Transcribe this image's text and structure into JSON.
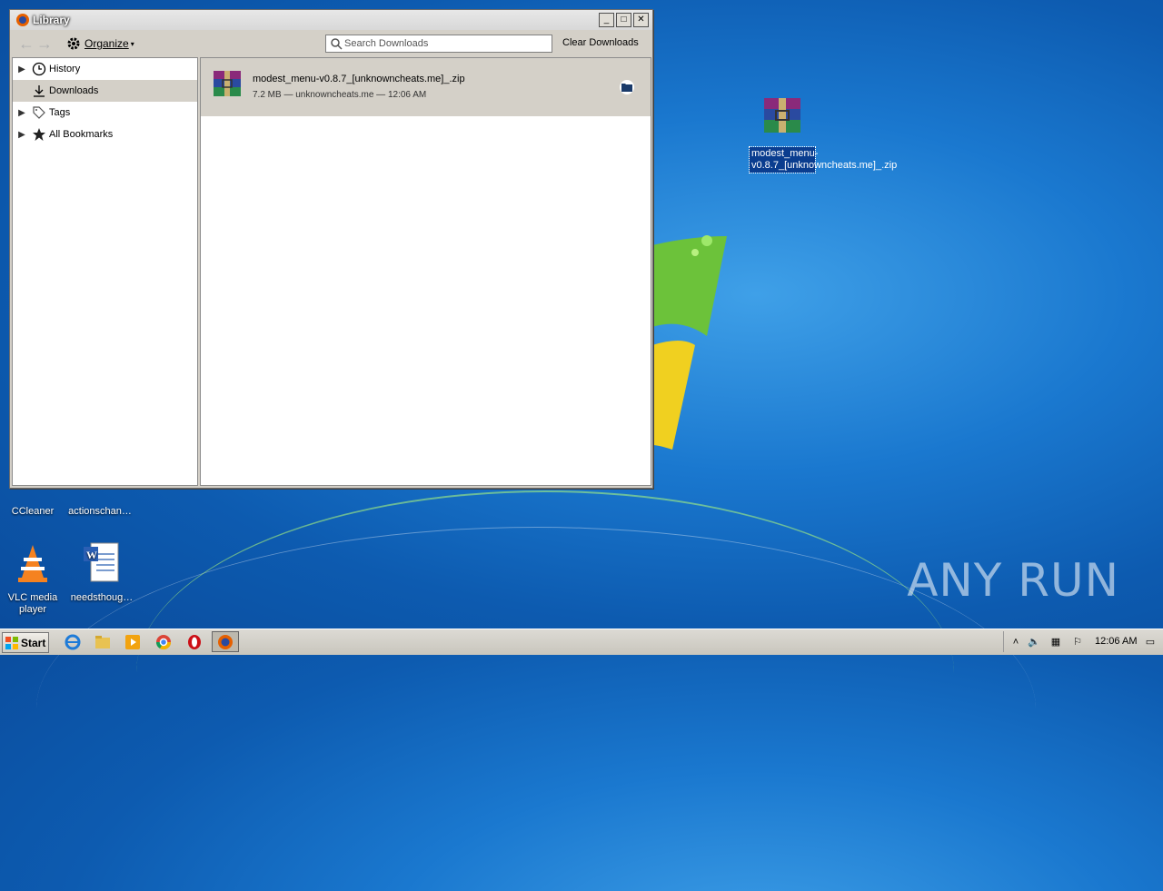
{
  "window": {
    "title": "Library",
    "toolbar": {
      "organize_label": "Organize",
      "search_placeholder": "Search Downloads",
      "clear_label": "Clear Downloads"
    },
    "sidebar": {
      "items": [
        {
          "label": "History",
          "icon": "clock-icon"
        },
        {
          "label": "Downloads",
          "icon": "download-icon"
        },
        {
          "label": "Tags",
          "icon": "tag-icon"
        },
        {
          "label": "All Bookmarks",
          "icon": "star-icon"
        }
      ]
    },
    "downloads": [
      {
        "filename": "modest_menu-v0.8.7_[unknowncheats.me]_.zip",
        "meta": "7.2 MB — unknowncheats.me — 12:06 AM",
        "icon": "winrar-archive-icon"
      }
    ]
  },
  "desktop": {
    "icons": [
      {
        "label": "modest_menu-v0.8.7_[unknowncheats.me]_.zip",
        "icon": "winrar-archive-icon",
        "selected": true
      },
      {
        "label": "CCleaner",
        "icon": "ccleaner-icon"
      },
      {
        "label": "actionschan…",
        "icon": "document-icon"
      },
      {
        "label": "VLC media player",
        "icon": "vlc-icon"
      },
      {
        "label": "needsthoug…",
        "icon": "word-document-icon"
      }
    ],
    "watermark": "ANY RUN"
  },
  "taskbar": {
    "start_label": "Start",
    "clock": "12:06 AM",
    "pinned": [
      "internet-explorer-icon",
      "explorer-icon",
      "media-player-icon",
      "chrome-icon",
      "opera-icon",
      "firefox-icon"
    ]
  },
  "colors": {
    "desktop_blue": "#1a78cf",
    "window_gray": "#d4d0c8",
    "selected_blue": "#0a3d8f"
  }
}
